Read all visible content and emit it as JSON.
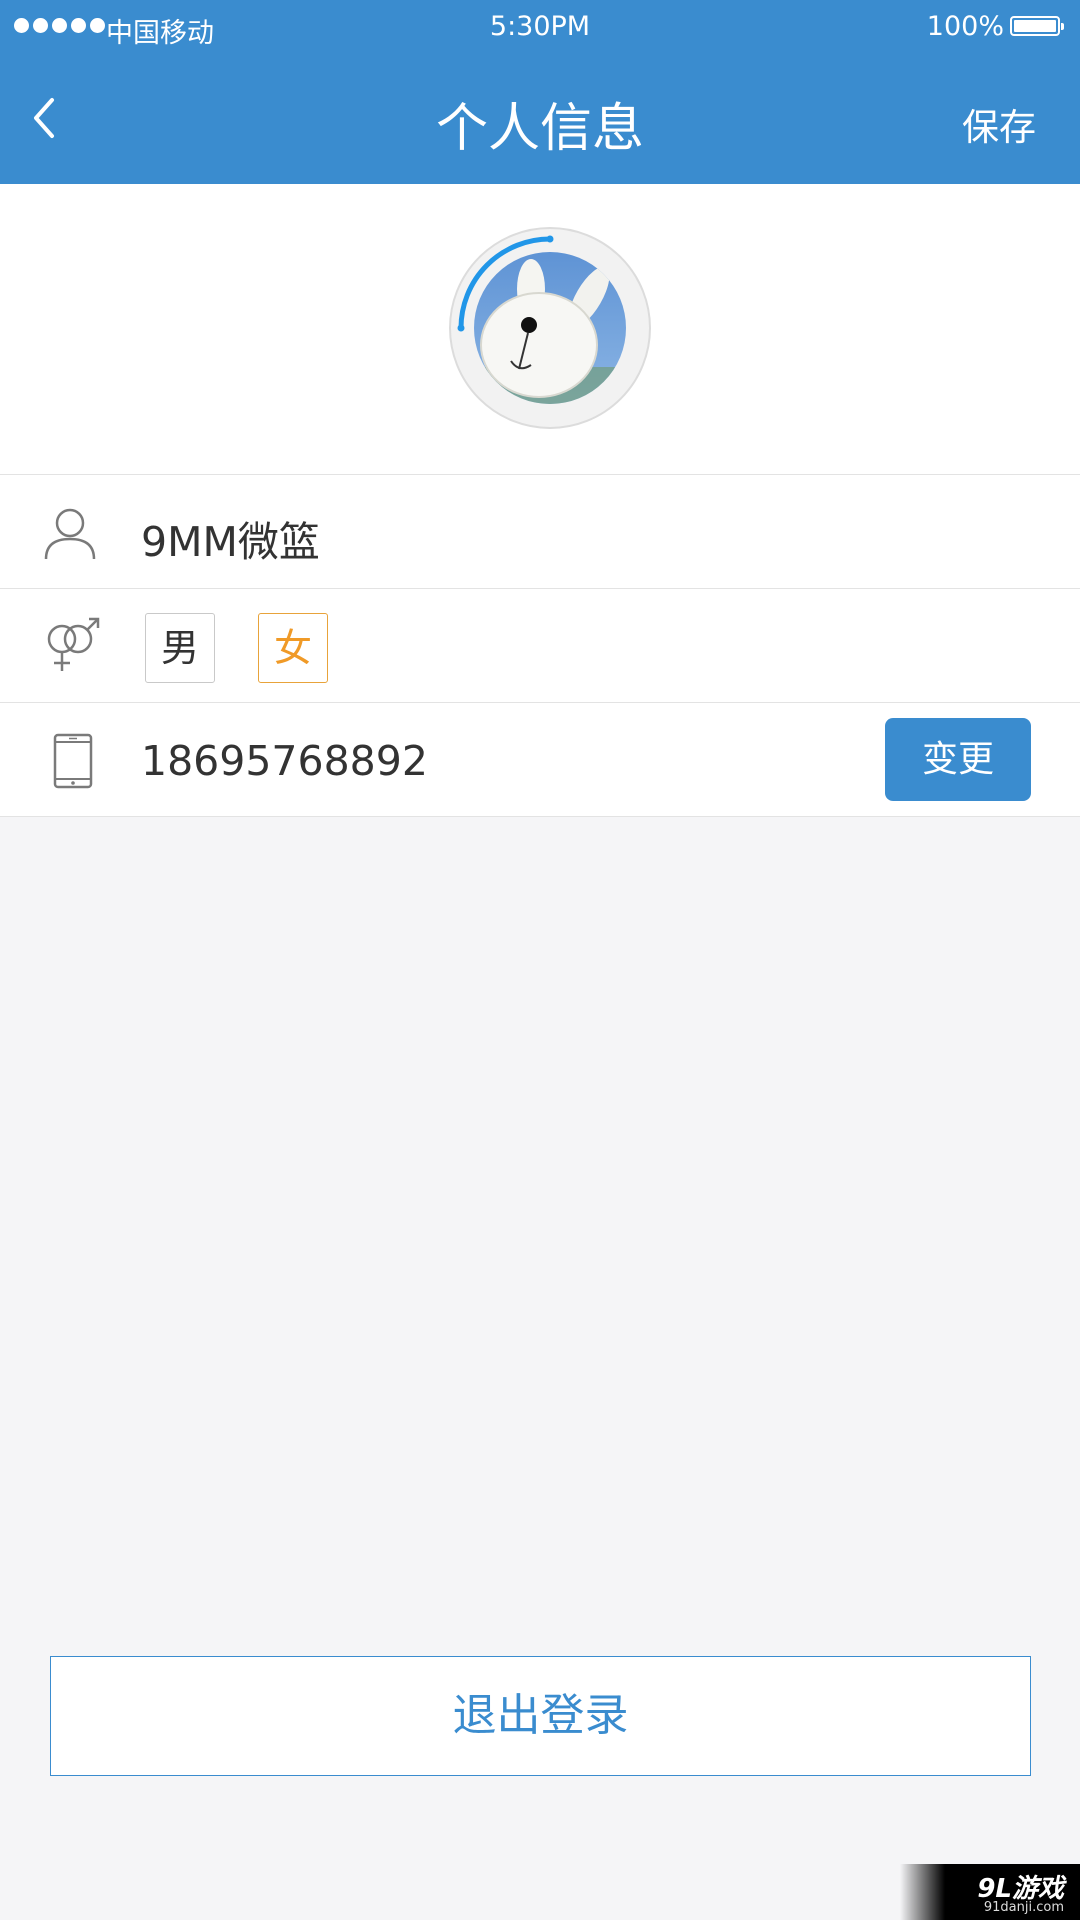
{
  "status_bar": {
    "carrier": "中国移动",
    "time": "5:30PM",
    "battery": "100%"
  },
  "nav": {
    "title": "个人信息",
    "save_label": "保存",
    "back_icon": "chevron-left-icon"
  },
  "profile": {
    "avatar_icon": "avatar-photo",
    "nickname": "9MM微篮",
    "gender_options": [
      "男",
      "女"
    ],
    "selected_gender": "女",
    "phone": "18695768892",
    "change_label": "变更"
  },
  "colors": {
    "primary": "#3a8ccf",
    "selected_gender": "#f09a27",
    "background": "#f5f5f7"
  },
  "logout_label": "退出登录",
  "watermark": {
    "brand": "9L游戏",
    "site": "91danji.com"
  }
}
